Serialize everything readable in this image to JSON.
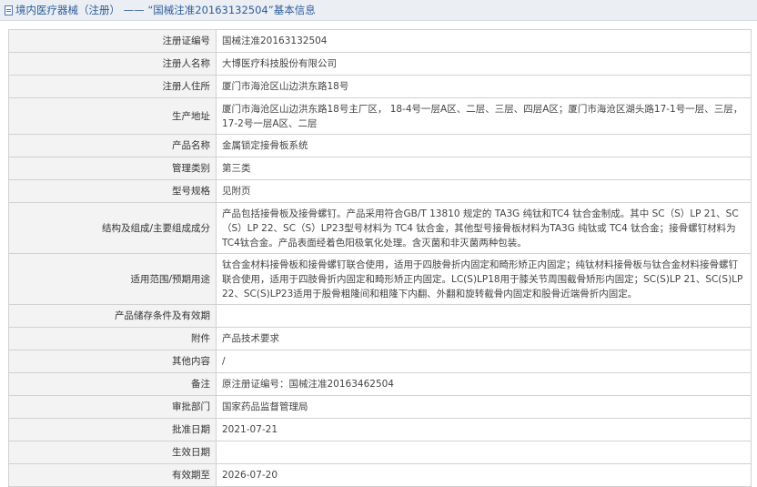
{
  "breadcrumb": {
    "part1": "境内医疗器械（注册）",
    "separator": " —— ",
    "part2": "“国械注准20163132504”基本信息"
  },
  "rows": [
    {
      "label": "注册证编号",
      "value": "国械注准20163132504"
    },
    {
      "label": "注册人名称",
      "value": "大博医疗科技股份有限公司"
    },
    {
      "label": "注册人住所",
      "value": "厦门市海沧区山边洪东路18号"
    },
    {
      "label": "生产地址",
      "value": "厦门市海沧区山边洪东路18号主厂区， 18-4号一层A区、二层、三层、四层A区；厦门市海沧区湖头路17-1号一层、三层，17-2号一层A区、二层"
    },
    {
      "label": "产品名称",
      "value": "金属锁定接骨板系统"
    },
    {
      "label": "管理类别",
      "value": "第三类"
    },
    {
      "label": "型号规格",
      "value": "见附页"
    },
    {
      "label": "结构及组成/主要组成成分",
      "value": "产品包括接骨板及接骨螺钉。产品采用符合GB/T 13810 规定的 TA3G 纯钛和TC4 钛合金制成。其中 SC（S）LP 21、SC（S）LP 22、SC（S）LP23型号材料为 TC4 钛合金，其他型号接骨板材料为TA3G 纯钛或 TC4 钛合金；接骨螺钉材料为TC4钛合金。产品表面经着色阳极氧化处理。含灭菌和非灭菌两种包装。"
    },
    {
      "label": "适用范围/预期用途",
      "value": "钛合金材料接骨板和接骨螺钉联合使用，适用于四肢骨折内固定和畸形矫正内固定；纯钛材料接骨板与钛合金材料接骨螺钉联合使用，适用于四肢骨折内固定和畸形矫正内固定。LC(S)LP18用于膝关节周围截骨矫形内固定；SC(S)LP 21、SC(S)LP 22、SC(S)LP23适用于股骨粗隆间和粗隆下内翻、外翻和旋转截骨内固定和股骨近端骨折内固定。"
    },
    {
      "label": "产品储存条件及有效期",
      "value": ""
    },
    {
      "label": "附件",
      "value": "产品技术要求"
    },
    {
      "label": "其他内容",
      "value": "/"
    },
    {
      "label": "备注",
      "value": "原注册证编号：国械注准20163462504"
    },
    {
      "label": "审批部门",
      "value": "国家药品监督管理局"
    },
    {
      "label": "批准日期",
      "value": "2021-07-21"
    },
    {
      "label": "生效日期",
      "value": ""
    },
    {
      "label": "有效期至",
      "value": "2026-07-20"
    }
  ]
}
